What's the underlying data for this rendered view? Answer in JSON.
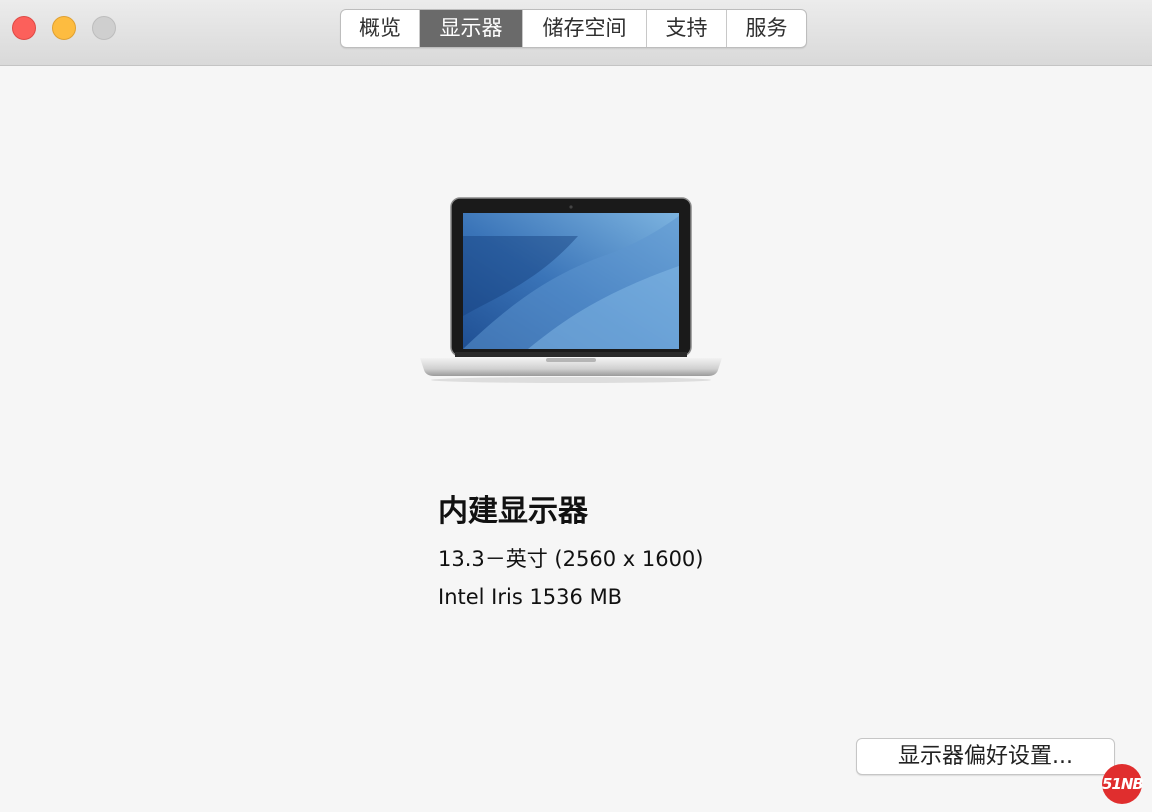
{
  "window": {
    "traffic_lights": [
      "close",
      "minimize",
      "zoom"
    ]
  },
  "tabs": [
    {
      "label": "概览",
      "active": false
    },
    {
      "label": "显示器",
      "active": true
    },
    {
      "label": "储存空间",
      "active": false
    },
    {
      "label": "支持",
      "active": false
    },
    {
      "label": "服务",
      "active": false
    }
  ],
  "display": {
    "name": "内建显示器",
    "size_resolution": "13.3－英寸 (2560 x 1600)",
    "graphics": "Intel Iris 1536 MB"
  },
  "actions": {
    "display_prefs_label": "显示器偏好设置..."
  },
  "watermark": {
    "text": "51NB"
  },
  "icons": {
    "laptop": "macbook-pro-icon"
  },
  "colors": {
    "close": "#fc605b",
    "minimize": "#fdbc40",
    "zoom": "#cfcfcf",
    "active_tab": "#6a6a6a",
    "watermark": "#e02e2e"
  }
}
